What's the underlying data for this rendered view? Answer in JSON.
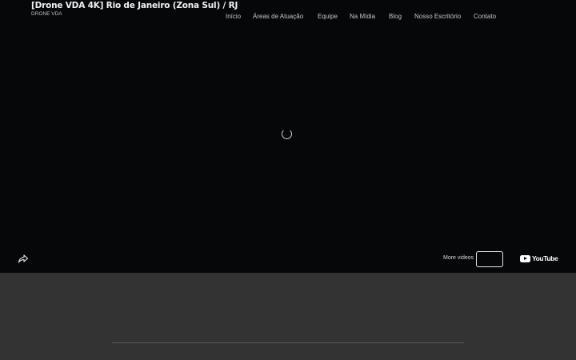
{
  "video": {
    "title": "[Drone VDA 4K] Rio de Janeiro (Zona Sul) / RJ",
    "channel": "DRONE VDA",
    "more_videos_label": "More videos",
    "youtube_label": "YouTube"
  },
  "nav": {
    "items": [
      "Início",
      "Áreas de Atuação",
      "Equipe",
      "Na Mídia",
      "Blog",
      "Nosso Escritório",
      "Contato"
    ]
  },
  "colors": {
    "video_bg": "#060708",
    "page_bg": "#333333",
    "nav_text": "#c5c5c5"
  }
}
